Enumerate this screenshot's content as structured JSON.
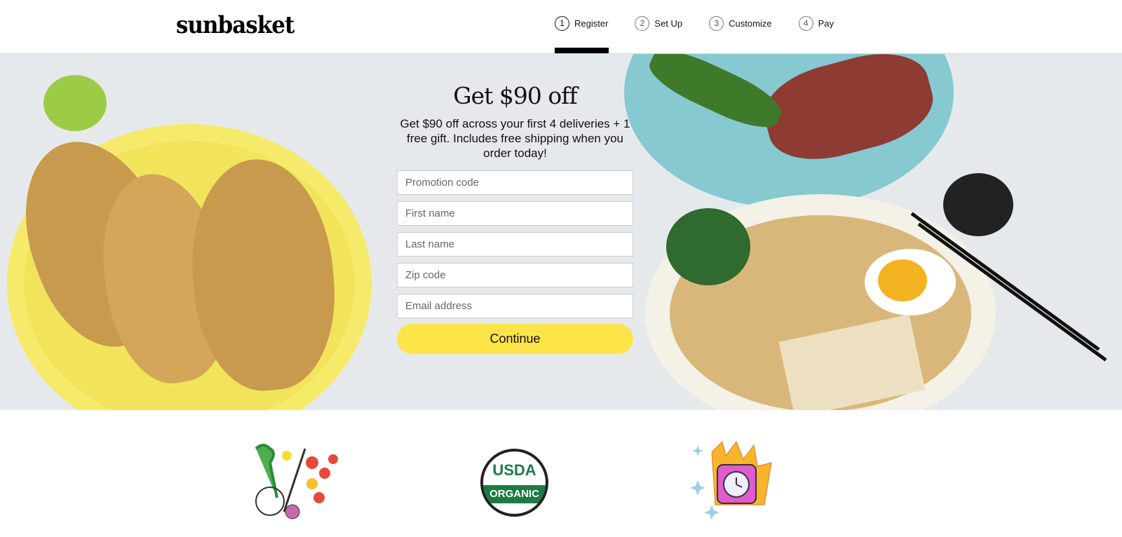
{
  "header": {
    "logo": "sunbasket",
    "steps": [
      {
        "num": "1",
        "label": "Register",
        "active": true
      },
      {
        "num": "2",
        "label": "Set Up"
      },
      {
        "num": "3",
        "label": "Customize"
      },
      {
        "num": "4",
        "label": "Pay"
      }
    ]
  },
  "hero": {
    "title": "Get $90 off",
    "subtitle": "Get $90 off across your first 4 deliveries + 1 free gift. Includes free shipping when you order today!",
    "fields": {
      "promo": "Promotion code",
      "first": "First name",
      "last": "Last name",
      "zip": "Zip code",
      "email": "Email address"
    },
    "continue": "Continue"
  },
  "features": {
    "icons": [
      "vegetables-illustration",
      "usda-organic-seal",
      "timer-fire-illustration"
    ],
    "usda_text": "USDA",
    "organic_text": "ORGANIC"
  },
  "colors": {
    "accent": "#fde449",
    "usda_green": "#1e7a45"
  }
}
